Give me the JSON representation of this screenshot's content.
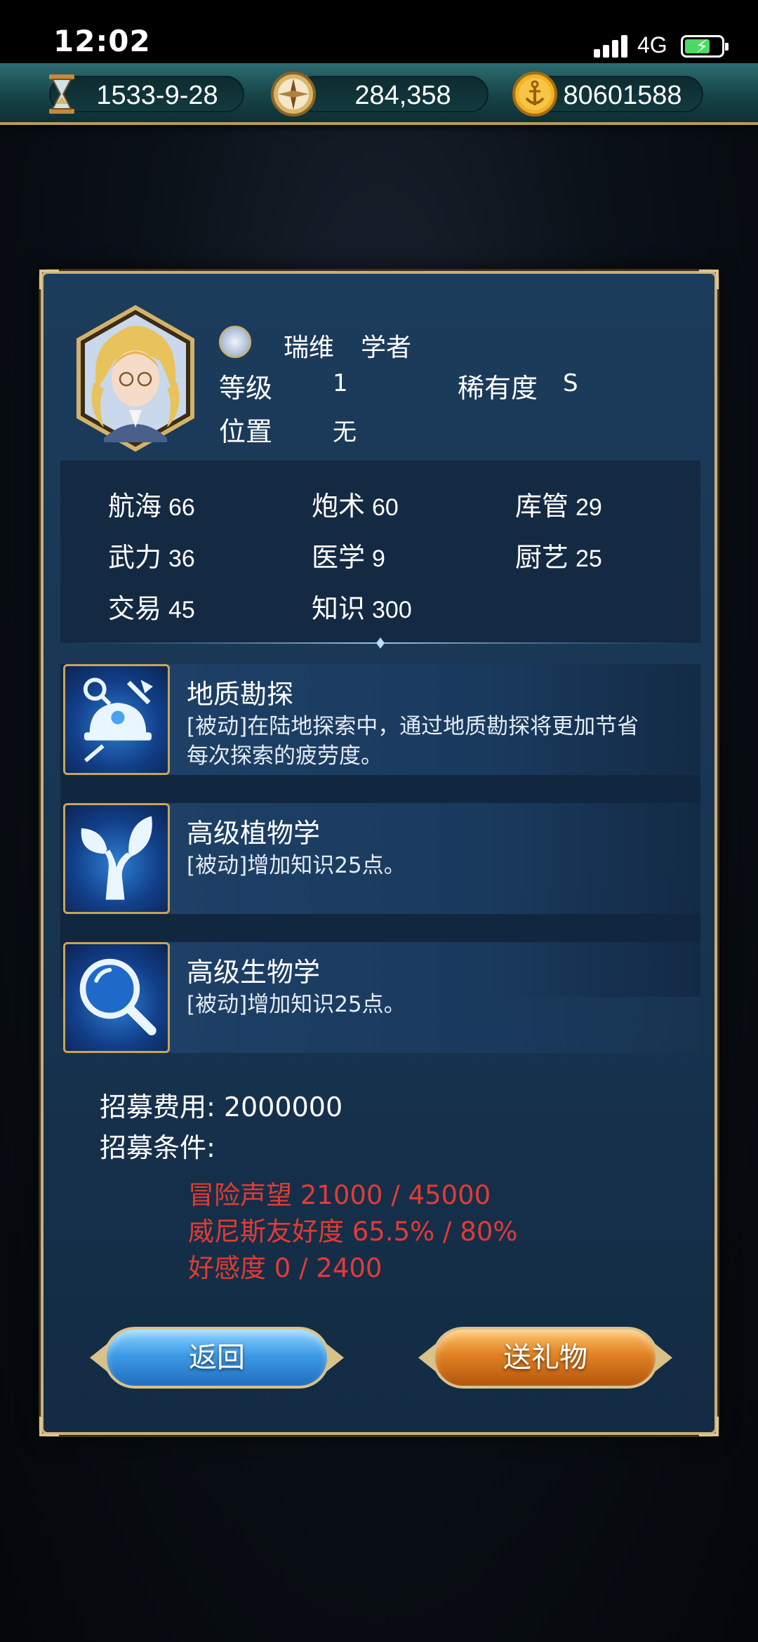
{
  "status_bar": {
    "time": "12:02",
    "network": "4G",
    "battery_level": 0.7
  },
  "resources": [
    {
      "icon": "hourglass-icon",
      "value": "1533-9-28"
    },
    {
      "icon": "compass-icon",
      "value": "284,358"
    },
    {
      "icon": "anchor-coin-icon",
      "value": "80601588"
    }
  ],
  "character": {
    "name": "瑞维",
    "class": "学者",
    "level_label": "等级",
    "level": "1",
    "rarity_label": "稀有度",
    "rarity": "S",
    "position_label": "位置",
    "position": "无"
  },
  "stats": [
    {
      "label": "航海",
      "value": "66"
    },
    {
      "label": "炮术",
      "value": "60"
    },
    {
      "label": "库管",
      "value": "29"
    },
    {
      "label": "武力",
      "value": "36"
    },
    {
      "label": "医学",
      "value": "9"
    },
    {
      "label": "厨艺",
      "value": "25"
    },
    {
      "label": "交易",
      "value": "45"
    },
    {
      "label": "知识",
      "value": "300"
    }
  ],
  "skills": [
    {
      "icon": "geology-helmet-icon",
      "title": "地质勘探",
      "desc_line1": "[被动]在陆地探索中，通过地质勘探将更加节省",
      "desc_line2": "每次探索的疲劳度。"
    },
    {
      "icon": "plant-sprout-icon",
      "title": "高级植物学",
      "desc_line1": "[被动]增加知识25点。",
      "desc_line2": ""
    },
    {
      "icon": "magnifier-icon",
      "title": "高级生物学",
      "desc_line1": "[被动]增加知识25点。",
      "desc_line2": ""
    }
  ],
  "recruit": {
    "cost_text": "招募费用: 2000000",
    "conditions_label": "招募条件:",
    "conditions": [
      "冒险声望 21000 / 45000",
      "威尼斯友好度 65.5% / 80%",
      "好感度 0 / 2400"
    ],
    "condition_color": "#e23b33"
  },
  "buttons": {
    "back": "返回",
    "gift": "送礼物"
  }
}
